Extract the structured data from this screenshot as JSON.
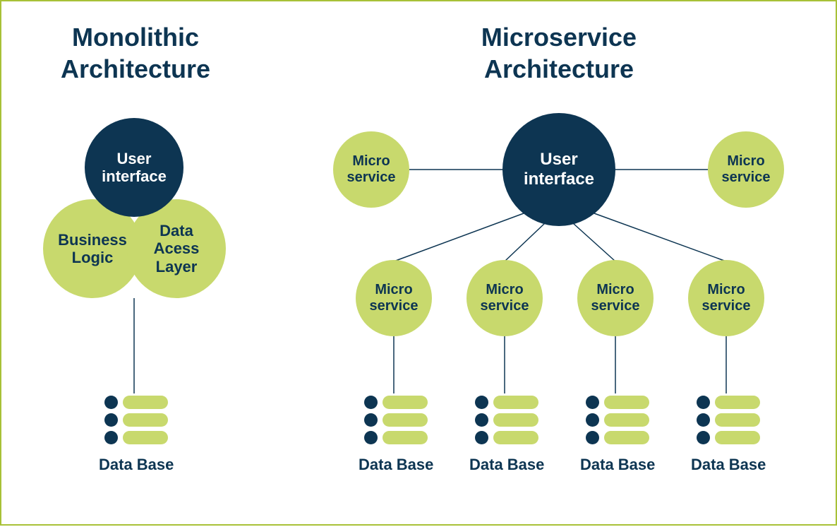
{
  "monolithic": {
    "title": "Monolithic\nArchitecture",
    "ui": "User\ninterface",
    "business": "Business\nLogic",
    "data_access": "Data\nAcess\nLayer",
    "db_label": "Data Base"
  },
  "microservice": {
    "title": "Microservice\nArchitecture",
    "ui": "User\ninterface",
    "ms_label": "Micro\nservice",
    "db_label": "Data Base"
  }
}
